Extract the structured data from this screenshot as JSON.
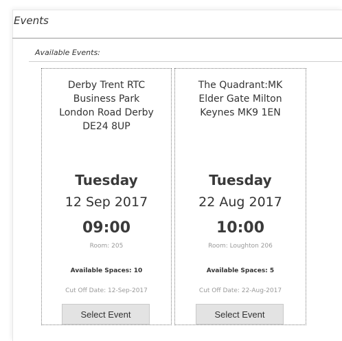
{
  "section": {
    "title": "Events",
    "available_label": "Available Events:"
  },
  "events": [
    {
      "address": [
        "Derby Trent RTC",
        "Business Park",
        "London Road Derby",
        "DE24 8UP"
      ],
      "day": "Tuesday",
      "date": "12 Sep 2017",
      "time": "09:00",
      "room": "Room: 205",
      "spaces": "Available Spaces: 10",
      "cutoff": "Cut Off Date: 12-Sep-2017",
      "button_label": "Select Event"
    },
    {
      "address": [
        "The Quadrant:MK",
        "Elder Gate Milton",
        "Keynes MK9 1EN"
      ],
      "day": "Tuesday",
      "date": "22 Aug 2017",
      "time": "10:00",
      "room": "Room: Loughton 206",
      "spaces": "Available Spaces: 5",
      "cutoff": "Cut Off Date: 22-Aug-2017",
      "button_label": "Select Event"
    }
  ]
}
